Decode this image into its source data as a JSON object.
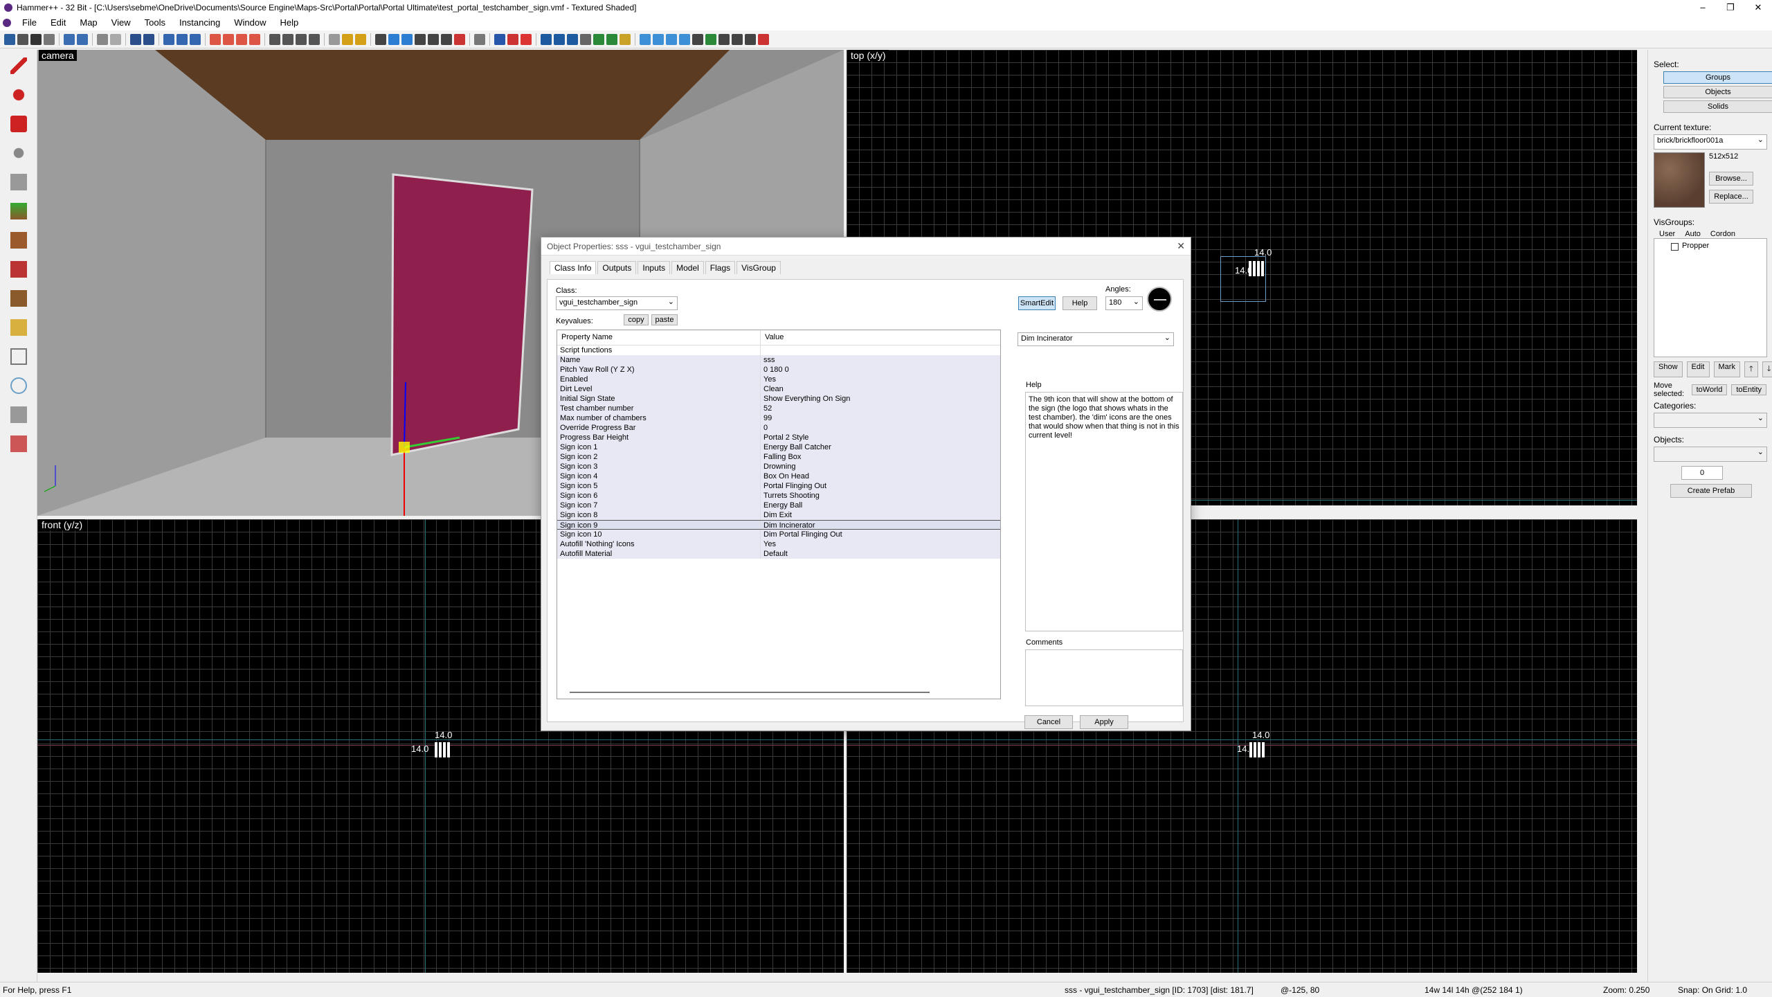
{
  "window": {
    "title": "Hammer++ - 32 Bit - [C:\\Users\\sebme\\OneDrive\\Documents\\Source Engine\\Maps-Src\\Portal\\Portal\\Portal Ultimate\\test_portal_testchamber_sign.vmf - Textured Shaded]",
    "controls": [
      "–",
      "❐",
      "✕"
    ]
  },
  "menu": [
    "File",
    "Edit",
    "Map",
    "View",
    "Tools",
    "Instancing",
    "Window",
    "Help"
  ],
  "viewports": {
    "camera": "camera",
    "top": "top (x/y)",
    "front": "front (y/z)",
    "marker_value": "14.0"
  },
  "right_panel": {
    "select_label": "Select:",
    "select_buttons": [
      "Groups",
      "Objects",
      "Solids"
    ],
    "current_texture_label": "Current texture:",
    "current_texture": "brick/brickfloor001a",
    "texture_size": "512x512",
    "browse": "Browse...",
    "replace": "Replace...",
    "visgroups_label": "VisGroups:",
    "visgroup_tabs": [
      "User",
      "Auto",
      "Cordon"
    ],
    "visgroup_item": "Propper",
    "vis_buttons": [
      "Show",
      "Edit",
      "Mark",
      "🡑",
      "🡓"
    ],
    "move_selected": "Move selected:",
    "to_world": "toWorld",
    "to_entity": "toEntity",
    "categories_label": "Categories:",
    "objects_label": "Objects:",
    "objects_count": "0",
    "create_prefab": "Create Prefab"
  },
  "status": {
    "help": "For Help, press F1",
    "selection": "sss - vgui_testchamber_sign [ID: 1703] [dist: 181.7]",
    "cursor": "@-125, 80",
    "size": "14w 14l 14h @(252 184 1)",
    "zoom": "Zoom: 0.250",
    "snap": "Snap: On Grid: 1.0"
  },
  "dialog": {
    "title": "Object Properties: sss - vgui_testchamber_sign",
    "close": "✕",
    "tabs": [
      "Class Info",
      "Outputs",
      "Inputs",
      "Model",
      "Flags",
      "VisGroup"
    ],
    "class_label": "Class:",
    "class_value": "vgui_testchamber_sign",
    "keyvalues_label": "Keyvalues:",
    "copy": "copy",
    "paste": "paste",
    "smartedit": "SmartEdit",
    "help_btn": "Help",
    "angles_label": "Angles:",
    "angles_value": "180",
    "col_name": "Property Name",
    "col_value": "Value",
    "rows": [
      {
        "name": "Script functions",
        "value": ""
      },
      {
        "name": "Name",
        "value": "sss"
      },
      {
        "name": "Pitch Yaw Roll (Y Z X)",
        "value": "0 180 0"
      },
      {
        "name": "Enabled",
        "value": "Yes"
      },
      {
        "name": "Dirt Level",
        "value": "Clean"
      },
      {
        "name": "Initial Sign State",
        "value": "Show Everything On Sign"
      },
      {
        "name": "Test chamber number",
        "value": "52"
      },
      {
        "name": "Max number of chambers",
        "value": "99"
      },
      {
        "name": "Override Progress Bar",
        "value": "0"
      },
      {
        "name": "Progress Bar Height",
        "value": "Portal 2 Style"
      },
      {
        "name": "Sign icon 1",
        "value": "Energy Ball Catcher"
      },
      {
        "name": "Sign icon 2",
        "value": "Falling Box"
      },
      {
        "name": "Sign icon 3",
        "value": "Drowning"
      },
      {
        "name": "Sign icon 4",
        "value": "Box On Head"
      },
      {
        "name": "Sign icon 5",
        "value": "Portal Flinging Out"
      },
      {
        "name": "Sign icon 6",
        "value": "Turrets Shooting"
      },
      {
        "name": "Sign icon 7",
        "value": "Energy Ball"
      },
      {
        "name": "Sign icon 8",
        "value": "Dim Exit"
      },
      {
        "name": "Sign icon 9",
        "value": "Dim Incinerator"
      },
      {
        "name": "Sign icon 10",
        "value": "Dim Portal Flinging Out"
      },
      {
        "name": "Autofill 'Nothing' Icons",
        "value": "Yes"
      },
      {
        "name": "Autofill Material",
        "value": "Default"
      }
    ],
    "value_combo": "Dim Incinerator",
    "help_label": "Help",
    "help_text": "The 9th icon that will show at the bottom of the sign (the logo that shows whats in the test chamber). the 'dim' icons are the ones that would show when that thing is not in this current level!",
    "comments_label": "Comments",
    "cancel": "Cancel",
    "apply": "Apply"
  }
}
